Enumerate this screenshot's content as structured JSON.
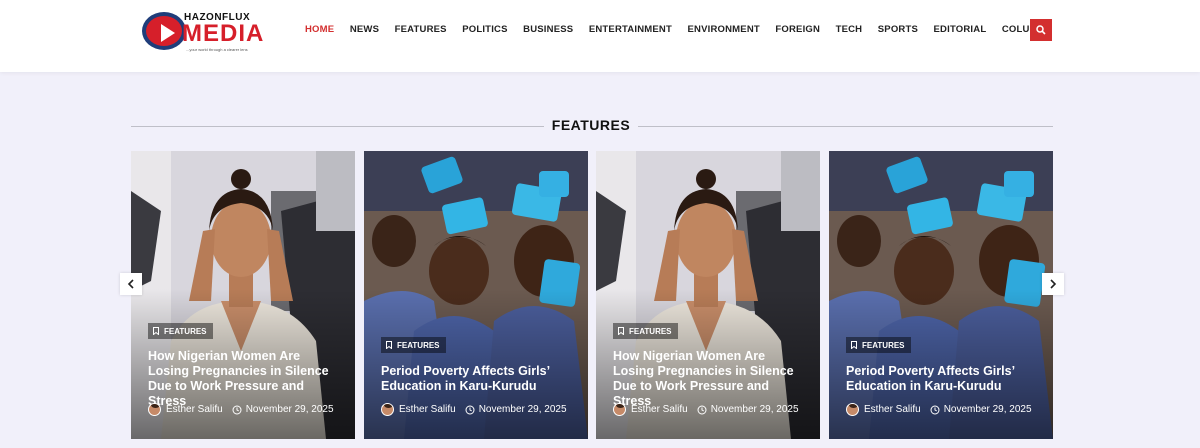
{
  "header": {
    "logo": {
      "top": "HAZONFLUX",
      "main": "MEDIA",
      "tagline": "...your world through a clearer lens"
    },
    "nav": [
      "HOME",
      "NEWS",
      "FEATURES",
      "POLITICS",
      "BUSINESS",
      "ENTERTAINMENT",
      "ENVIRONMENT",
      "FOREIGN",
      "TECH",
      "SPORTS",
      "EDITORIAL",
      "COLUMNS"
    ],
    "active_nav": "HOME",
    "search_icon": "search-icon"
  },
  "section": {
    "title": "FEATURES"
  },
  "cards": [
    {
      "category": "FEATURES",
      "title": "How Nigerian Women Are Losing Pregnancies in Silence Due to Work Pressure and Stress",
      "author": "Esther Salifu",
      "date": "November 29, 2025",
      "image": "stressed-woman-photo"
    },
    {
      "category": "FEATURES",
      "title": "Period Poverty Affects Girls’ Education in Karu-Kurudu",
      "author": "Esther Salifu",
      "date": "November 29, 2025",
      "image": "schoolgirls-with-pads-photo"
    },
    {
      "category": "FEATURES",
      "title": "How Nigerian Women Are Losing Pregnancies in Silence Due to Work Pressure and Stress",
      "author": "Esther Salifu",
      "date": "November 29, 2025",
      "image": "stressed-woman-photo"
    },
    {
      "category": "FEATURES",
      "title": "Period Poverty Affects Girls’ Education in Karu-Kurudu",
      "author": "Esther Salifu",
      "date": "November 29, 2025",
      "image": "schoolgirls-with-pads-photo"
    }
  ],
  "colors": {
    "accent": "#d32f2f",
    "background": "#f1f0fa"
  }
}
